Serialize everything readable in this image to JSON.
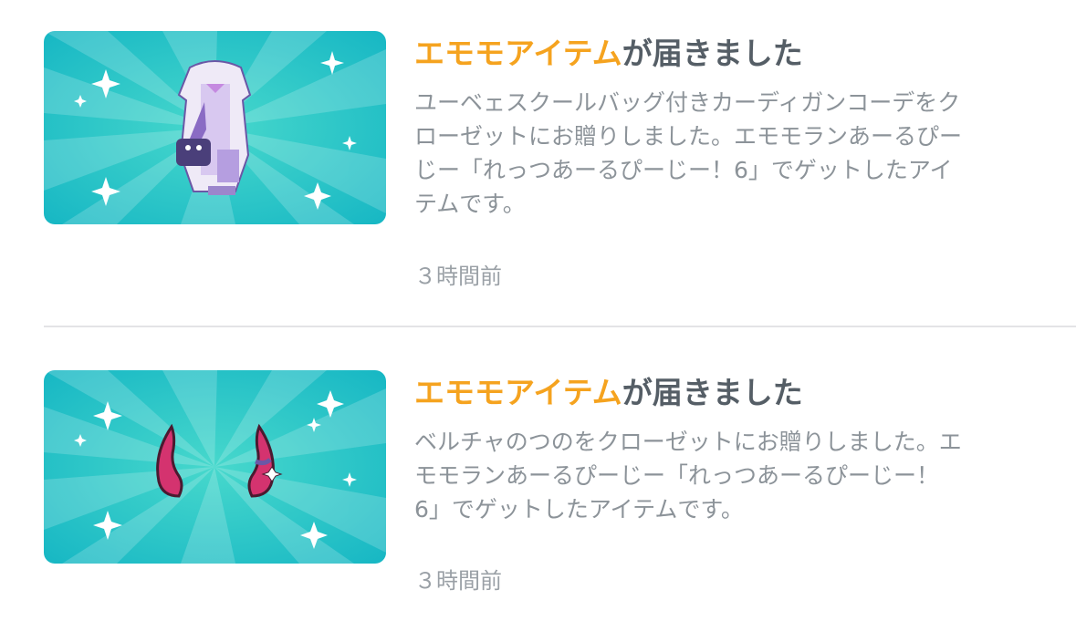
{
  "notifications": [
    {
      "title_highlight": "エモモアイテム",
      "title_rest": "が届きました",
      "body": "ユーベェスクールバッグ付きカーディガンコーデをク\nローゼットにお贈りしました。エモモランあーるぴー\nじー「れっつあーるぴーじー！6」でゲットしたアイ\nテムです。",
      "time": "３時間前",
      "thumbnail_icon": "cardigan-outfit-icon"
    },
    {
      "title_highlight": "エモモアイテム",
      "title_rest": "が届きました",
      "body": "ベルチャのつのをクローゼットにお贈りしました。エ\nモモランあーるぴーじー「れっつあーるぴーじー！\n6」でゲットしたアイテムです。",
      "time": "３時間前",
      "thumbnail_icon": "demon-horns-icon"
    }
  ],
  "colors": {
    "highlight": "#f5a31f",
    "title": "#555e66",
    "body": "#8c9399",
    "thumbnail_bg": "#2ec7c0"
  }
}
